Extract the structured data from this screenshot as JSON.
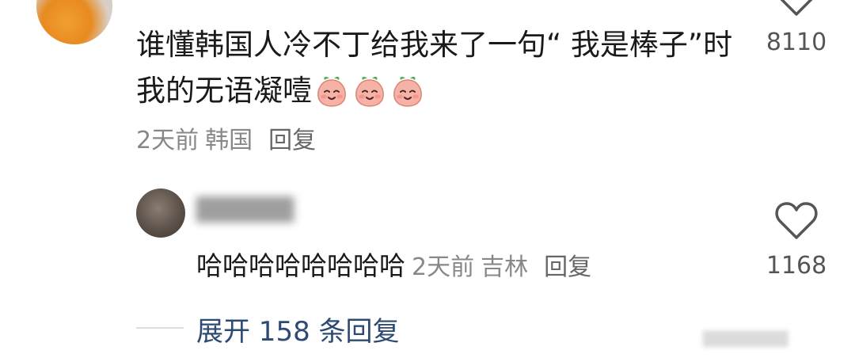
{
  "main_comment": {
    "text": "谁懂韩国人冷不丁给我来了一句“ 我是棒子”时我的无语凝噎",
    "emoji_icons": [
      "peach-face-emoji",
      "peach-face-emoji",
      "peach-face-emoji"
    ],
    "time": "2天前",
    "location": "韩国",
    "reply_label": "回复",
    "like_count": "8110"
  },
  "reply_comment": {
    "author_name": "",
    "text": "哈哈哈哈哈哈哈哈",
    "time": "2天前",
    "location": "吉林",
    "reply_label": "回复",
    "like_count": "1168"
  },
  "expand": {
    "label": "展开 158 条回复"
  },
  "colors": {
    "text_primary": "#1a1a1a",
    "text_secondary": "#888888",
    "link_blue": "#2c4a73",
    "background": "#ffffff"
  }
}
